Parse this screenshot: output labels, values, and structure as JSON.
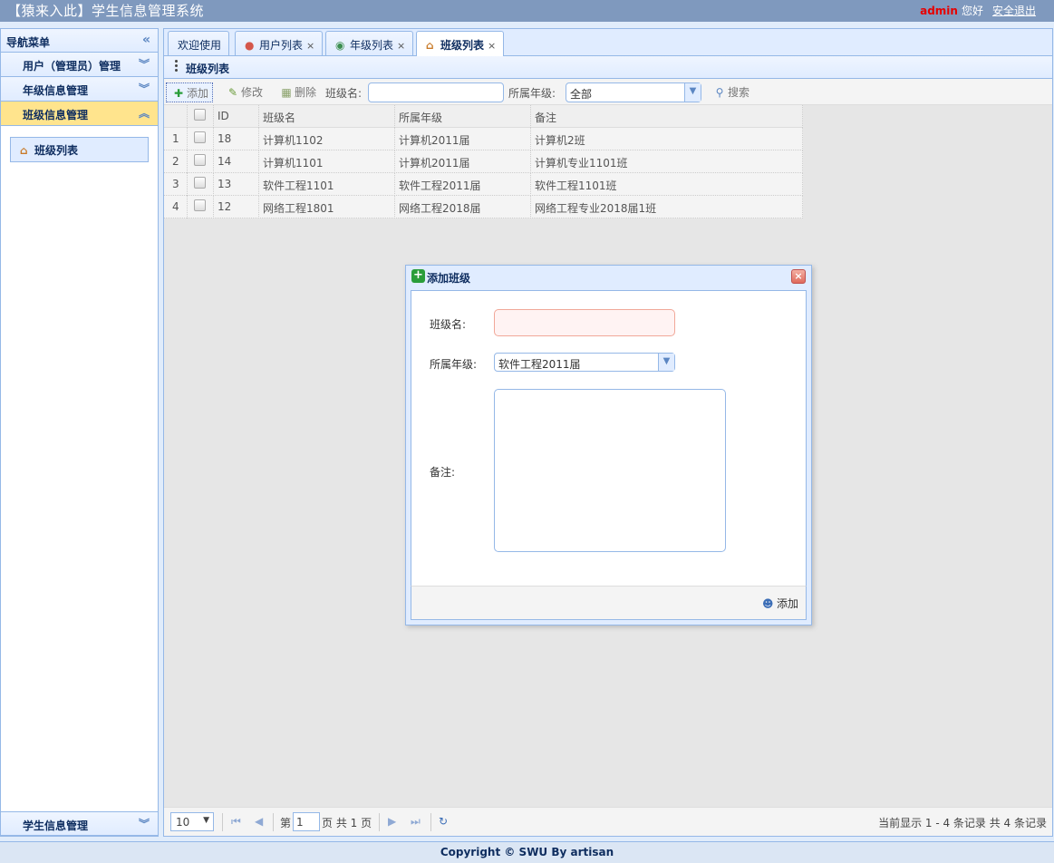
{
  "header": {
    "title": "【猿来入此】学生信息管理系统",
    "username": "admin",
    "greeting": "您好",
    "logout": "安全退出"
  },
  "sidebar": {
    "title": "导航菜单",
    "sections": [
      {
        "label": "用户（管理员）管理"
      },
      {
        "label": "年级信息管理"
      },
      {
        "label": "班级信息管理"
      }
    ],
    "active_items": [
      {
        "label": "班级列表"
      }
    ],
    "bottom_section": {
      "label": "学生信息管理"
    }
  },
  "tabs": [
    {
      "label": "欢迎使用"
    },
    {
      "label": "用户列表"
    },
    {
      "label": "年级列表"
    },
    {
      "label": "班级列表"
    }
  ],
  "panel": {
    "title": "班级列表"
  },
  "toolbar": {
    "add": "添加",
    "edit": "修改",
    "delete": "删除",
    "class_name_label": "班级名:",
    "grade_label": "所属年级:",
    "grade_value": "全部",
    "search": "搜索"
  },
  "table": {
    "columns": [
      "ID",
      "班级名",
      "所属年级",
      "备注"
    ],
    "rows": [
      {
        "num": "1",
        "id": "18",
        "name": "计算机1102",
        "grade": "计算机2011届",
        "remark": "计算机2班"
      },
      {
        "num": "2",
        "id": "14",
        "name": "计算机1101",
        "grade": "计算机2011届",
        "remark": "计算机专业1101班"
      },
      {
        "num": "3",
        "id": "13",
        "name": "软件工程1101",
        "grade": "软件工程2011届",
        "remark": "软件工程1101班"
      },
      {
        "num": "4",
        "id": "12",
        "name": "网络工程1801",
        "grade": "网络工程2018届",
        "remark": "网络工程专业2018届1班"
      }
    ]
  },
  "pager": {
    "page_size": "10",
    "page_prefix": "第",
    "page_value": "1",
    "page_suffix": "页 共 1 页",
    "summary": "当前显示 1 - 4 条记录 共 4 条记录"
  },
  "dialog": {
    "title": "添加班级",
    "class_name_label": "班级名:",
    "grade_label": "所属年级:",
    "grade_value": "软件工程2011届",
    "remark_label": "备注:",
    "add_button": "添加"
  },
  "footer": {
    "text": "Copyright © SWU By artisan"
  },
  "colors": {
    "header_bg": "#7f99be",
    "accent_border": "#95b8e7",
    "active_section": "#ffe48d",
    "username": "#e60000"
  }
}
